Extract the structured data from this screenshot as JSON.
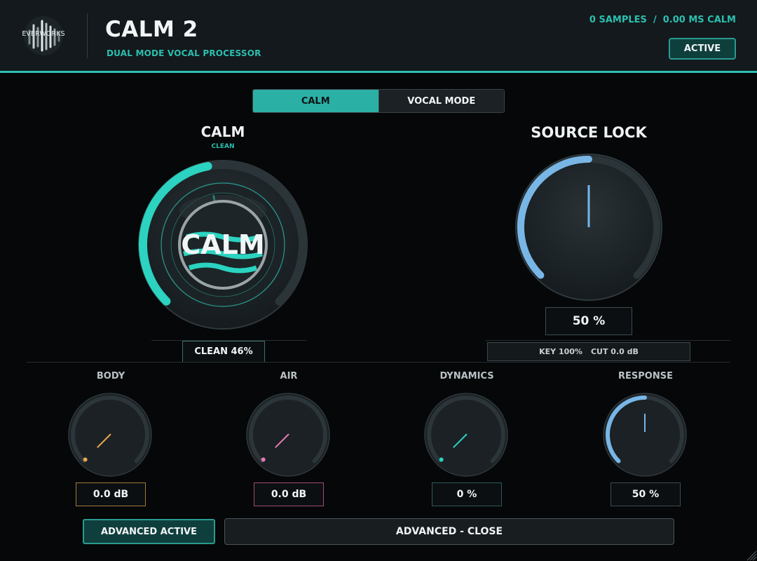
{
  "header": {
    "logo_text": "EVERWORKS",
    "title": "CALM 2",
    "subtitle": "DUAL MODE VOCAL PROCESSOR",
    "latency": "0 SAMPLES  /  0.00 MS CALM",
    "active_label": "ACTIVE"
  },
  "mode_switch": {
    "calm_label": "CALM",
    "vocal_mode_label": "VOCAL MODE",
    "selected": "CALM"
  },
  "calm_section": {
    "title": "CALM",
    "sublabel": "CLEAN",
    "knob_text": "CALM",
    "clean_value": "CLEAN 46%",
    "clean_fraction": 0.46
  },
  "source_lock": {
    "title": "SOURCE LOCK",
    "value": "50 %",
    "fraction": 0.5,
    "key_label": "KEY 100%",
    "cut_label": "CUT 0.0 dB"
  },
  "small_knobs": [
    {
      "label": "BODY",
      "value": "0.0 dB",
      "fraction": 0.0,
      "color": "#e8a94a"
    },
    {
      "label": "AIR",
      "value": "0.0 dB",
      "fraction": 0.0,
      "color": "#e57bb5"
    },
    {
      "label": "DYNAMICS",
      "value": "0 %",
      "fraction": 0.0,
      "color": "#2bd3c0"
    },
    {
      "label": "RESPONSE",
      "value": "50 %",
      "fraction": 0.5,
      "color": "#78b6e6"
    }
  ],
  "footer": {
    "advanced_active_label": "ADVANCED ACTIVE",
    "advanced_close_label": "ADVANCED - CLOSE"
  },
  "colors": {
    "accent": "#2bbfb0",
    "calm_arc": "#2bd3c0",
    "source_arc": "#78b6e6",
    "background": "#050708",
    "header": "#13191c"
  }
}
